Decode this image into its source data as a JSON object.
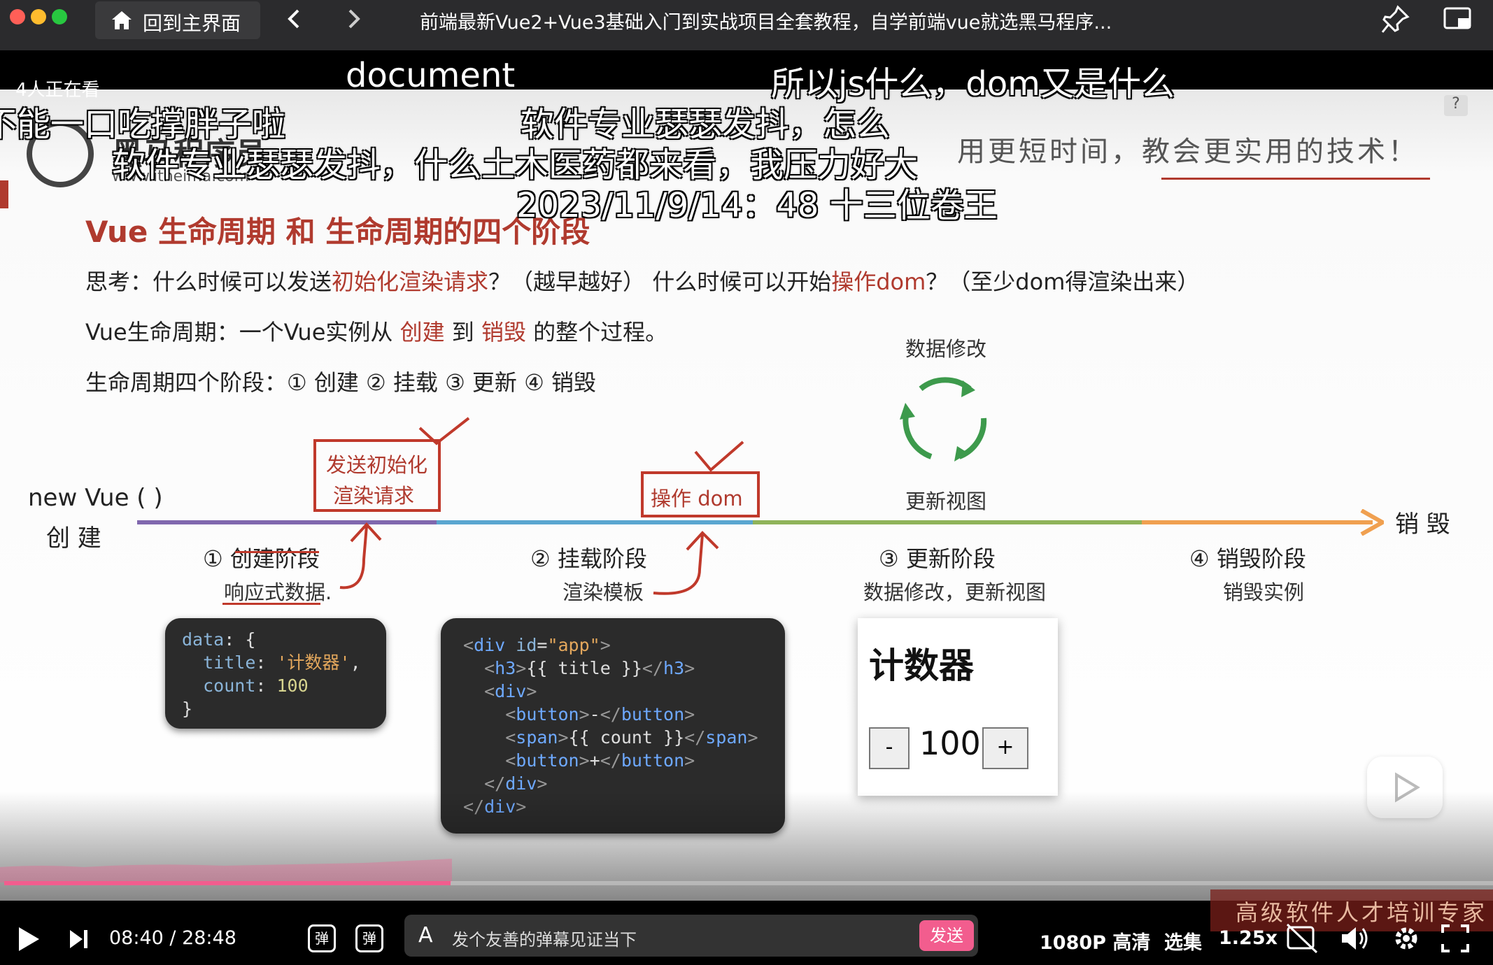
{
  "window": {
    "home_label": "回到主界面",
    "title": "前端最新Vue2+Vue3基础入门到实战项目全套教程，自学前端vue就选黑马程序...",
    "traffic": {
      "close": "#ff5f57",
      "min": "#febc2e",
      "max": "#28c840"
    }
  },
  "viewers": "4人正在看",
  "danmaku": [
    "document",
    "所以js什么，dom又是什么",
    "不能一口吃撑胖子啦",
    "软件专业瑟瑟发抖，怎么",
    "软件专业瑟瑟发抖，什么土木医药都来看，我压力好大",
    "2023/11/9/14：48 十三位卷王"
  ],
  "slide": {
    "logo_text": "黑马程序员",
    "logo_url": "www.itheima.com",
    "slogan": "用更短时间，教会更实用的技术！",
    "heading": "Vue 生命周期 和 生命周期的四个阶段",
    "think": {
      "p1": "思考：什么时候可以发送",
      "h1": "初始化渲染请求",
      "p2": "？（越早越好） 什么时候可以开始",
      "h2": "操作dom",
      "p3": "？（至少dom得渲染出来）"
    },
    "def": {
      "p1": "Vue生命周期：一个Vue实例从 ",
      "h1": "创建",
      "p2": " 到 ",
      "h2": "销毁",
      "p3": " 的整个过程。"
    },
    "stages_line": "生命周期四个阶段：① 创建 ② 挂载 ③ 更新 ④ 销毁",
    "new_vue": "new Vue ( )",
    "create": "创 建",
    "destroy_end": "销 毁",
    "box_request": [
      "发送初始化",
      "渲染请求"
    ],
    "box_dom": "操作 dom",
    "data_change": "数据修改",
    "update_view": "更新视图",
    "stages": [
      {
        "title": "① 创建阶段",
        "sub": "响应式数据."
      },
      {
        "title": "② 挂载阶段",
        "sub": "渲染模板"
      },
      {
        "title": "③ 更新阶段",
        "sub": "数据修改，更新视图"
      },
      {
        "title": "④ 销毁阶段",
        "sub": "销毁实例"
      }
    ],
    "timeline_colors": [
      "#8068ae",
      "#5aa6d0",
      "#8fb35a",
      "#f0a050"
    ],
    "counter": {
      "title": "计数器",
      "minus": "-",
      "value": "100",
      "plus": "+"
    }
  },
  "player": {
    "time": "08:40 / 28:48",
    "danmaku_placeholder": "发个友善的弹幕见证当下",
    "send": "发送",
    "quality": "1080P 高清",
    "episodes": "选集",
    "speed": "1.25x",
    "watermark": "高级软件人才培训专家",
    "progress_fraction": 0.3,
    "accent": "#f25d8e"
  }
}
